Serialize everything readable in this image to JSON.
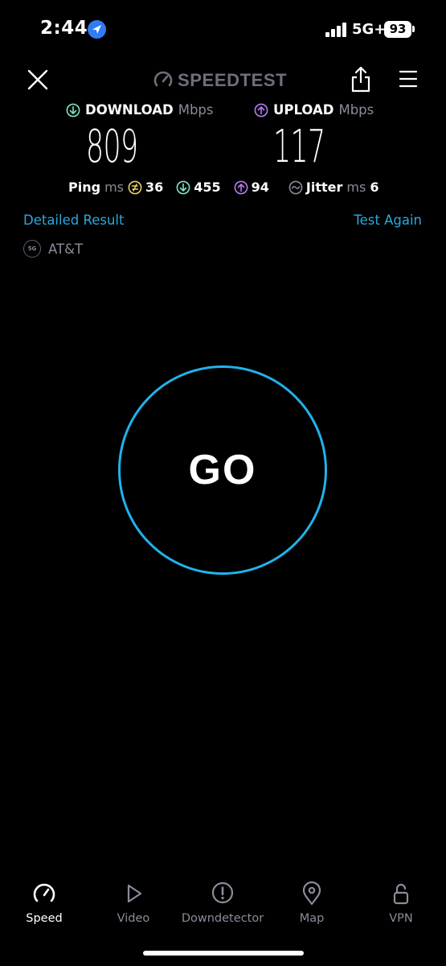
{
  "status_bar": {
    "time": "2:44",
    "network": "5G+",
    "battery": "93"
  },
  "header": {
    "brand": "SPEEDTEST"
  },
  "results": {
    "download": {
      "label": "DOWNLOAD",
      "unit": "Mbps",
      "value": "809"
    },
    "upload": {
      "label": "UPLOAD",
      "unit": "Mbps",
      "value": "117"
    },
    "ping": {
      "label": "Ping",
      "unit": "ms",
      "idle": "36",
      "download": "455",
      "upload": "94"
    },
    "jitter": {
      "label": "Jitter",
      "unit": "ms",
      "value": "6"
    }
  },
  "links": {
    "detailed": "Detailed Result",
    "test_again": "Test Again"
  },
  "provider": {
    "badge": "5G",
    "name": "AT&T"
  },
  "go_button": {
    "label": "GO"
  },
  "tabs": [
    {
      "label": "Speed",
      "icon": "speedometer-icon",
      "active": true
    },
    {
      "label": "Video",
      "icon": "play-icon",
      "active": false
    },
    {
      "label": "Downdetector",
      "icon": "alert-icon",
      "active": false
    },
    {
      "label": "Map",
      "icon": "map-pin-icon",
      "active": false
    },
    {
      "label": "VPN",
      "icon": "unlock-icon",
      "active": false
    }
  ],
  "colors": {
    "accent": "#21b2ec",
    "download": "#7ee3c8",
    "upload": "#b57cf3",
    "ping": "#e6d36a",
    "muted": "#8a8c99"
  }
}
